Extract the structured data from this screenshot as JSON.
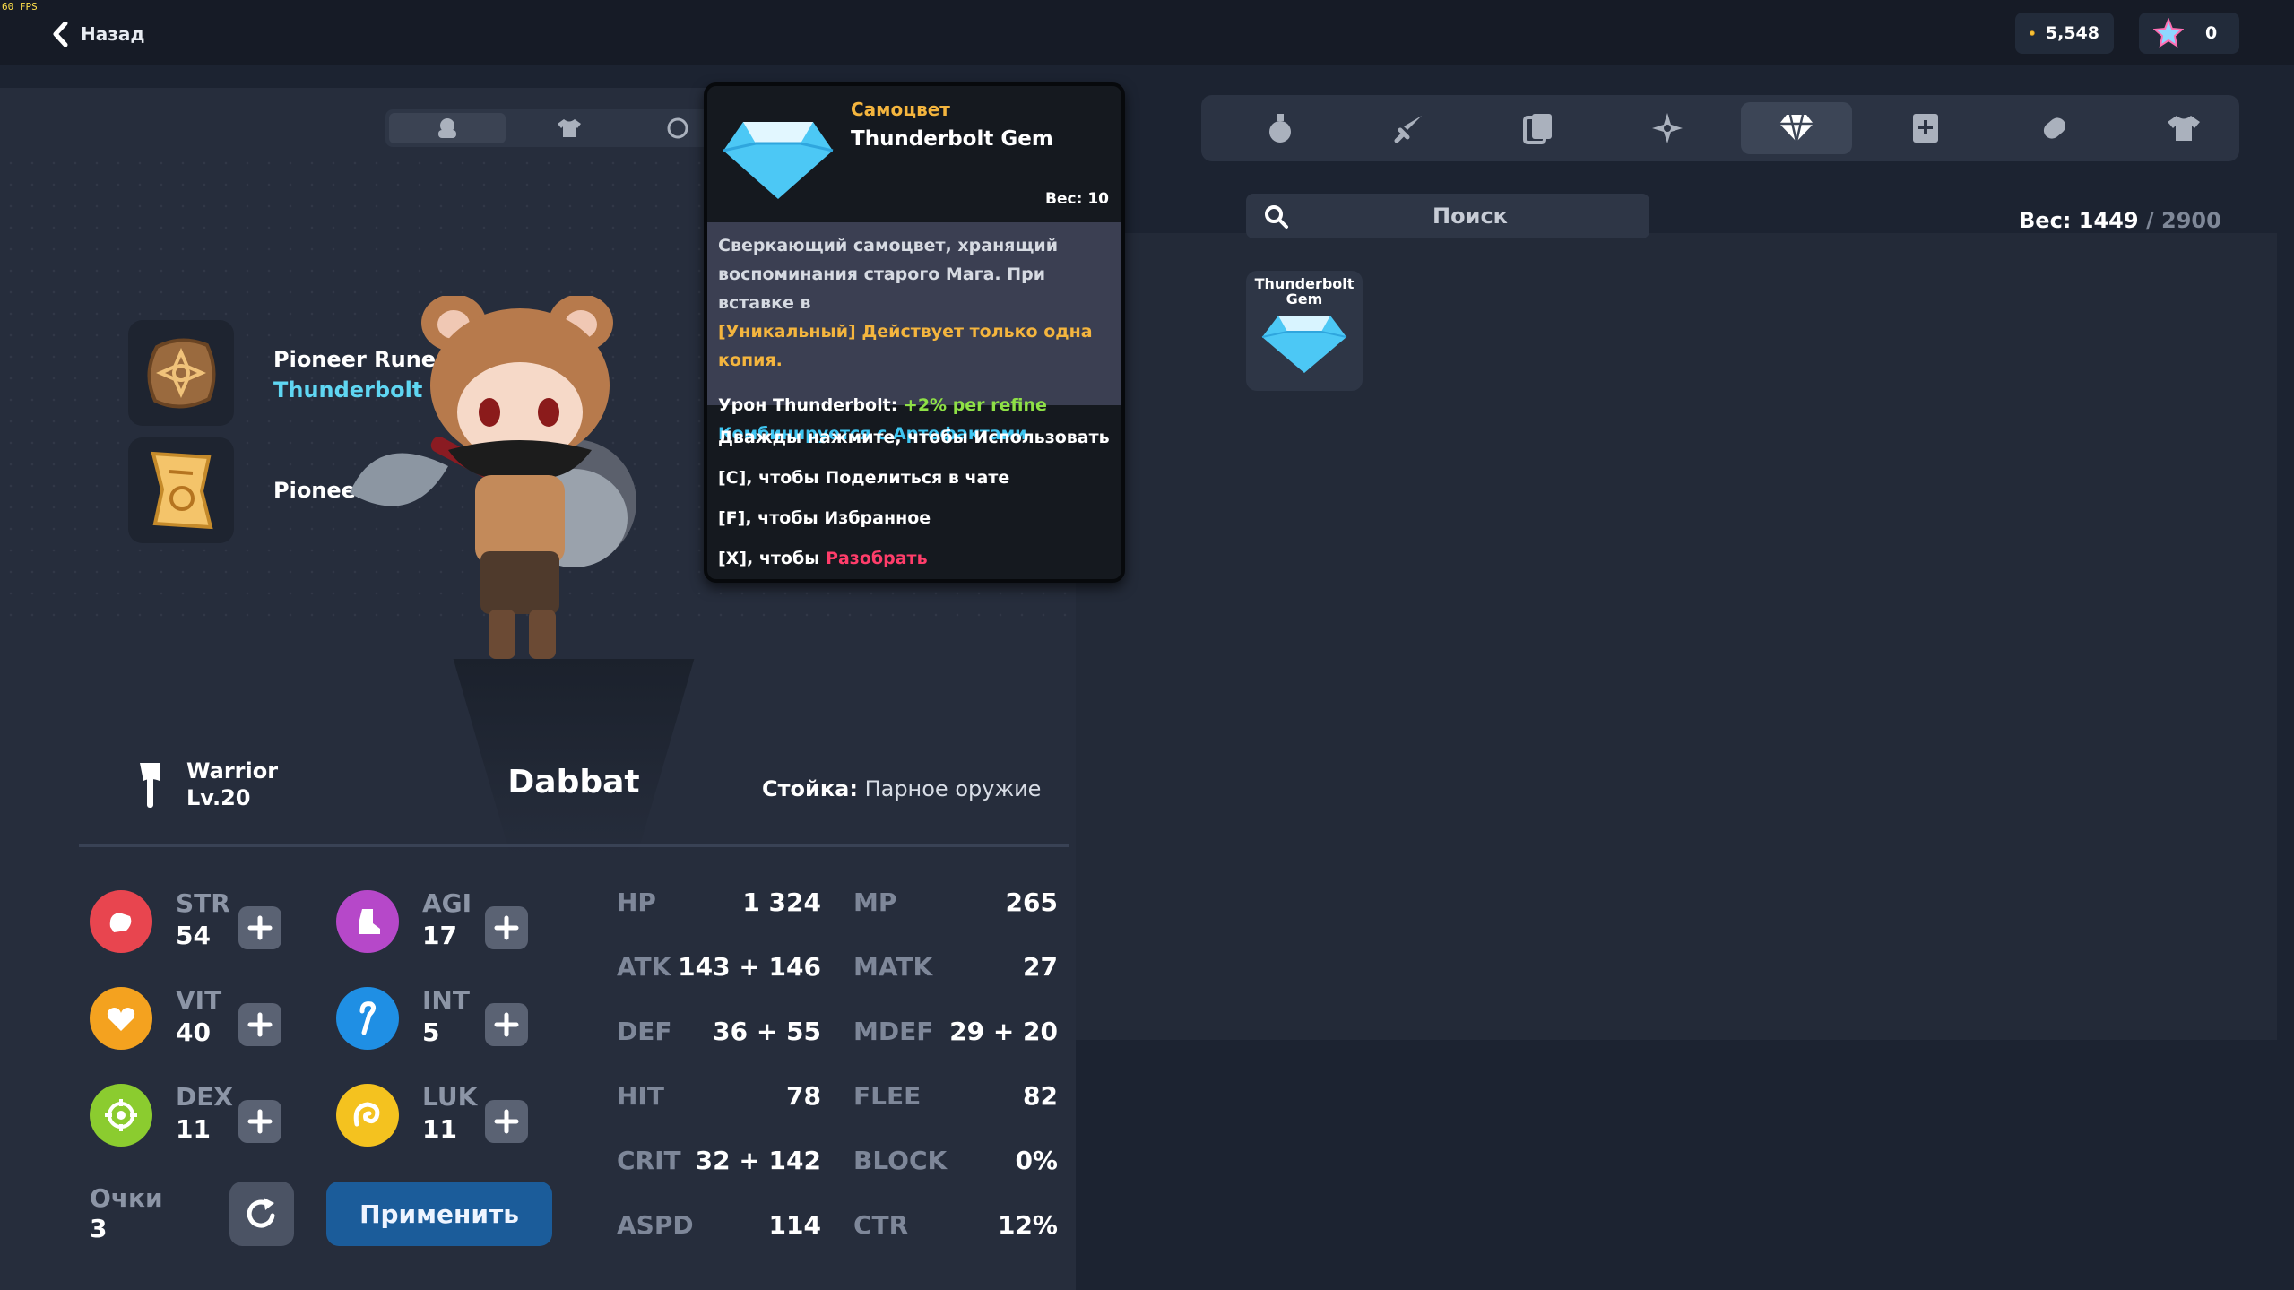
{
  "hud": {
    "fps": "60 FPS",
    "back_label": "Назад"
  },
  "currency": {
    "coins": "5,548",
    "stars": "0"
  },
  "equip_slots": [
    {
      "line1": "Pioneer Rune of",
      "line2": "Thunderbolt",
      "icon": "rune-icon"
    },
    {
      "line1": "Pioneer Sc",
      "line2": "",
      "icon": "scroll-icon"
    }
  ],
  "character": {
    "class": "Warrior",
    "level": "Lv.20",
    "name": "Dabbat",
    "stance_label": "Стойка:",
    "stance_value": "Парное оружие"
  },
  "base_stats": [
    {
      "name": "STR",
      "value": "54",
      "color": "#e8454f",
      "icon": "fist-icon"
    },
    {
      "name": "AGI",
      "value": "17",
      "color": "#b648c9",
      "icon": "boot-icon"
    },
    {
      "name": "VIT",
      "value": "40",
      "color": "#f4a21f",
      "icon": "heart-icon"
    },
    {
      "name": "INT",
      "value": "5",
      "color": "#1f8fe4",
      "icon": "staff-icon"
    },
    {
      "name": "DEX",
      "value": "11",
      "color": "#8bcc2f",
      "icon": "target-icon"
    },
    {
      "name": "LUK",
      "value": "11",
      "color": "#f4c21f",
      "icon": "clover-icon"
    }
  ],
  "points": {
    "label": "Очки",
    "value": "3"
  },
  "apply_label": "Применить",
  "derived_stats": [
    {
      "k": "HP",
      "v": "1 324"
    },
    {
      "k": "MP",
      "v": "265"
    },
    {
      "k": "ATK",
      "v": "143 + 146"
    },
    {
      "k": "MATK",
      "v": "27"
    },
    {
      "k": "DEF",
      "v": "36 + 55"
    },
    {
      "k": "MDEF",
      "v": "29 + 20"
    },
    {
      "k": "HIT",
      "v": "78"
    },
    {
      "k": "FLEE",
      "v": "82"
    },
    {
      "k": "CRIT",
      "v": "32 + 142"
    },
    {
      "k": "BLOCK",
      "v": "0%"
    },
    {
      "k": "ASPD",
      "v": "114"
    },
    {
      "k": "CTR",
      "v": "12%"
    }
  ],
  "inventory": {
    "categories": [
      "potion-icon",
      "sword-icon",
      "cards-icon",
      "shuriken-icon",
      "gem-icon",
      "plus-box-icon",
      "scroll-roll-icon",
      "shirt-icon"
    ],
    "selected_category": 4,
    "search_placeholder": "Поиск",
    "weight_label": "Вес: 1449",
    "weight_sep": " / ",
    "weight_max": "2900",
    "items": [
      {
        "name": "Thunderbolt Gem"
      }
    ]
  },
  "tooltip": {
    "type": "Самоцвет",
    "name": "Thunderbolt Gem",
    "weight": "Вес: 10",
    "desc_line1": "Сверкающий самоцвет, хранящий",
    "desc_line2": "воспоминания старого Мага. При вставке в",
    "unique_line": "[Уникальный] Действует только одна копия.",
    "bonus_label": "Урон Thunderbolt: ",
    "bonus_value": "+2% per refine",
    "combo": "Комбинируется с Артефактами",
    "actions": [
      "Дважды нажмите, чтобы Использовать",
      "[C], чтобы Поделиться в чате",
      "[F], чтобы Избранное"
    ],
    "dismantle_prefix": "[X], чтобы ",
    "dismantle_word": "Разобрать"
  }
}
